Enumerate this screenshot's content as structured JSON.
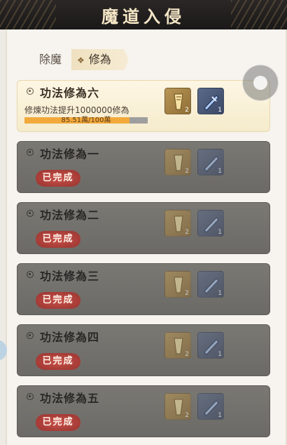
{
  "header": {
    "title": "魔道入侵"
  },
  "tabs": [
    {
      "label": "除魔"
    },
    {
      "label": "修為",
      "selected": true
    }
  ],
  "active_quest": {
    "name": "功法修為六",
    "description": "修煉功法提升1000000修為",
    "progress_text": "85.51萬/100萬",
    "progress_fraction": 0.8551,
    "rewards": [
      {
        "icon": "gold-scroll-icon",
        "count": "2"
      },
      {
        "icon": "blue-weapon-icon",
        "count": "1"
      }
    ]
  },
  "completed_quests": [
    {
      "name": "功法修為一",
      "status": "已完成",
      "rewards": [
        {
          "count": "2"
        },
        {
          "count": "1"
        }
      ]
    },
    {
      "name": "功法修為二",
      "status": "已完成",
      "rewards": [
        {
          "count": "2"
        },
        {
          "count": "1"
        }
      ]
    },
    {
      "name": "功法修為三",
      "status": "已完成",
      "rewards": [
        {
          "count": "2"
        },
        {
          "count": "1"
        }
      ]
    },
    {
      "name": "功法修為四",
      "status": "已完成",
      "rewards": [
        {
          "count": "2"
        },
        {
          "count": "1"
        }
      ]
    },
    {
      "name": "功法修為五",
      "status": "已完成",
      "rewards": [
        {
          "count": "2"
        },
        {
          "count": "1"
        }
      ]
    }
  ],
  "colors": {
    "header_bg": "#1f1c1b",
    "title_text": "#f4e6c6",
    "progress_fill": "#f2a93b",
    "done_badge": "#b4443e",
    "done_card": "#737170"
  }
}
